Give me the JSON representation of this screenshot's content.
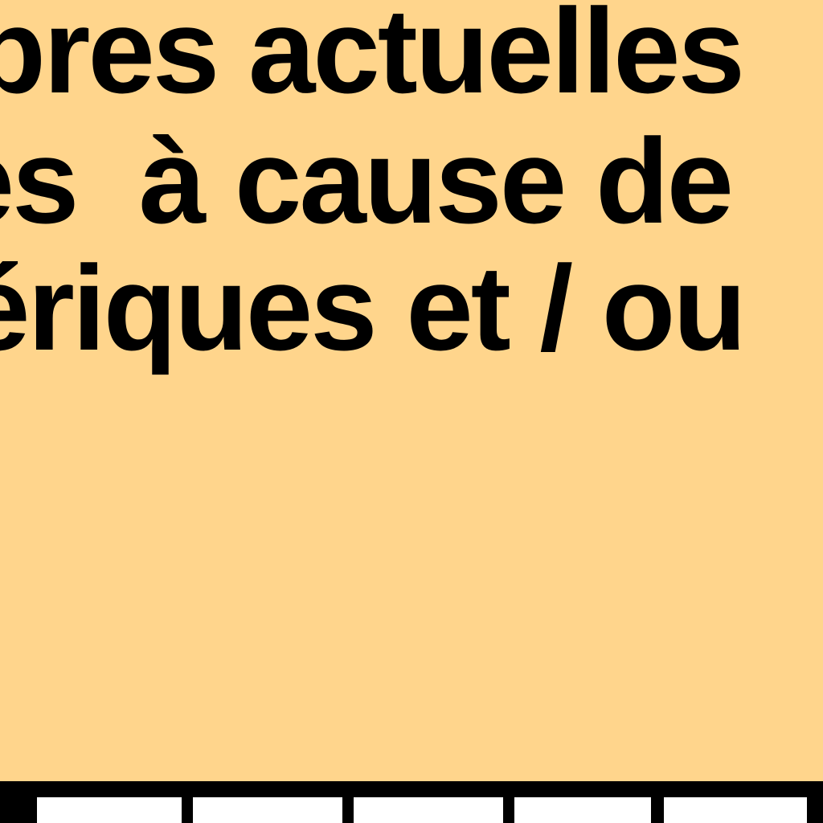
{
  "text_lines": [
    "ibres actuelles",
    "es  à cause de",
    "ériques et / ou"
  ],
  "colors": {
    "background": "#FFD58C",
    "text": "#000000",
    "strip": "#000000",
    "tab": "#FFFFFF"
  }
}
